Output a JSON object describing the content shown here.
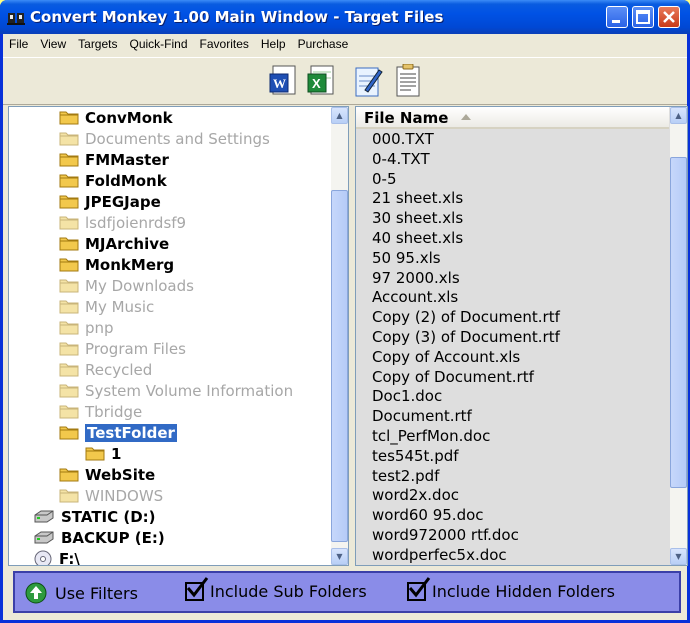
{
  "window": {
    "title": "Convert Monkey 1.00 Main Window - Target Files"
  },
  "menu": [
    "File",
    "View",
    "Targets",
    "Quick-Find",
    "Favorites",
    "Help",
    "Purchase"
  ],
  "toolbar_icons": [
    "word-doc-icon",
    "excel-sheet-icon",
    "notepad-edit-icon",
    "text-doc-icon"
  ],
  "tree": {
    "items": [
      {
        "label": "ConvMonk",
        "state": "bold",
        "indent": 1
      },
      {
        "label": "Documents and Settings",
        "state": "dim",
        "indent": 1
      },
      {
        "label": "FMMaster",
        "state": "bold",
        "indent": 1
      },
      {
        "label": "FoldMonk",
        "state": "bold",
        "indent": 1
      },
      {
        "label": "JPEGJape",
        "state": "bold",
        "indent": 1
      },
      {
        "label": "lsdfjoienrdsf9",
        "state": "dim",
        "indent": 1
      },
      {
        "label": "MJArchive",
        "state": "bold",
        "indent": 1
      },
      {
        "label": "MonkMerg",
        "state": "bold",
        "indent": 1
      },
      {
        "label": "My Downloads",
        "state": "dim",
        "indent": 1
      },
      {
        "label": "My Music",
        "state": "dim",
        "indent": 1
      },
      {
        "label": "pnp",
        "state": "dim",
        "indent": 1
      },
      {
        "label": "Program Files",
        "state": "dim",
        "indent": 1
      },
      {
        "label": "Recycled",
        "state": "dim",
        "indent": 1
      },
      {
        "label": "System Volume Information",
        "state": "dim",
        "indent": 1
      },
      {
        "label": "Tbridge",
        "state": "dim",
        "indent": 1
      },
      {
        "label": "TestFolder",
        "state": "sel",
        "indent": 1
      },
      {
        "label": "1",
        "state": "bold",
        "indent": 2
      },
      {
        "label": "WebSite",
        "state": "bold",
        "indent": 1
      },
      {
        "label": "WINDOWS",
        "state": "dim",
        "indent": 1
      },
      {
        "label": "STATIC (D:)",
        "state": "drive",
        "indent": 0
      },
      {
        "label": "BACKUP (E:)",
        "state": "drive",
        "indent": 0
      },
      {
        "label": "F:\\",
        "state": "cd",
        "indent": 0
      }
    ]
  },
  "files": {
    "header": "File Name",
    "items": [
      "000.TXT",
      "0-4.TXT",
      "0-5",
      "21 sheet.xls",
      "30 sheet.xls",
      "40 sheet.xls",
      "50 95.xls",
      "97 2000.xls",
      "Account.xls",
      "Copy (2) of Document.rtf",
      "Copy (3) of Document.rtf",
      "Copy of Account.xls",
      "Copy of Document.rtf",
      "Doc1.doc",
      "Document.rtf",
      "tcl_PerfMon.doc",
      "tes545t.pdf",
      "test2.pdf",
      "word2x.doc",
      "word60 95.doc",
      "word972000 rtf.doc",
      "wordperfec5x.doc"
    ]
  },
  "bottom": {
    "use_filters": "Use Filters",
    "include_sub": "Include Sub Folders",
    "include_hidden": "Include Hidden Folders"
  }
}
